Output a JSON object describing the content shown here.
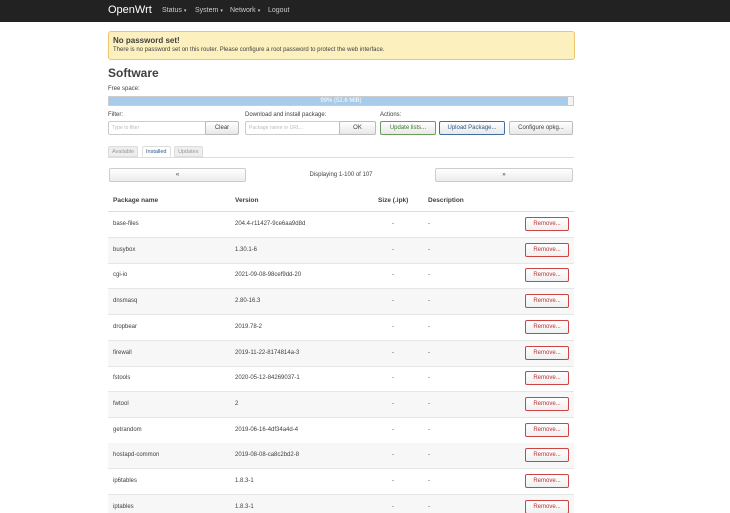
{
  "navbar": {
    "brand": "OpenWrt",
    "menu": [
      {
        "label": "Status",
        "has_caret": true
      },
      {
        "label": "System",
        "has_caret": true
      },
      {
        "label": "Network",
        "has_caret": true
      },
      {
        "label": "Logout",
        "has_caret": false
      }
    ],
    "caret_glyph": "▾"
  },
  "alert": {
    "title": "No password set!",
    "text": "There is no password set on this router. Please configure a root password to protect the web interface."
  },
  "page_title": "Software",
  "free_space": {
    "label": "Free space:",
    "percent": 99,
    "text": "99% (52.6 MiB)"
  },
  "filter": {
    "label": "Filter:",
    "placeholder": "Type to filter",
    "clear_label": "Clear"
  },
  "download": {
    "label": "Download and install package:",
    "placeholder": "Package name or URL...",
    "ok_label": "OK"
  },
  "actions": {
    "label": "Actions:",
    "update_lists": "Update lists...",
    "upload_package": "Upload Package...",
    "configure_opkg": "Configure opkg..."
  },
  "tabs": [
    {
      "label": "Available",
      "active": false
    },
    {
      "label": "Installed",
      "active": true
    },
    {
      "label": "Updates",
      "active": false
    }
  ],
  "pager": {
    "prev": "«",
    "next": "»",
    "text": "Displaying 1-100 of 107"
  },
  "table": {
    "columns": [
      "Package name",
      "Version",
      "Size (.ipk)",
      "Description"
    ],
    "remove_label": "Remove...",
    "rows": [
      {
        "name": "base-files",
        "version": "204.4-r11427-9ce6aa9d8d",
        "size": "-",
        "description": "-"
      },
      {
        "name": "busybox",
        "version": "1.30.1-6",
        "size": "-",
        "description": "-"
      },
      {
        "name": "cgi-io",
        "version": "2021-09-08-98cef9dd-20",
        "size": "-",
        "description": "-"
      },
      {
        "name": "dnsmasq",
        "version": "2.80-16.3",
        "size": "-",
        "description": "-"
      },
      {
        "name": "dropbear",
        "version": "2019.78-2",
        "size": "-",
        "description": "-"
      },
      {
        "name": "firewall",
        "version": "2019-11-22-8174814a-3",
        "size": "-",
        "description": "-"
      },
      {
        "name": "fstools",
        "version": "2020-05-12-84269037-1",
        "size": "-",
        "description": "-"
      },
      {
        "name": "fwtool",
        "version": "2",
        "size": "-",
        "description": "-"
      },
      {
        "name": "getrandom",
        "version": "2019-06-16-4df34a4d-4",
        "size": "-",
        "description": "-"
      },
      {
        "name": "hostapd-common",
        "version": "2019-08-08-ca8c2bd2-8",
        "size": "-",
        "description": "-"
      },
      {
        "name": "ip6tables",
        "version": "1.8.3-1",
        "size": "-",
        "description": "-"
      },
      {
        "name": "iptables",
        "version": "1.8.3-1",
        "size": "-",
        "description": "-"
      }
    ]
  }
}
